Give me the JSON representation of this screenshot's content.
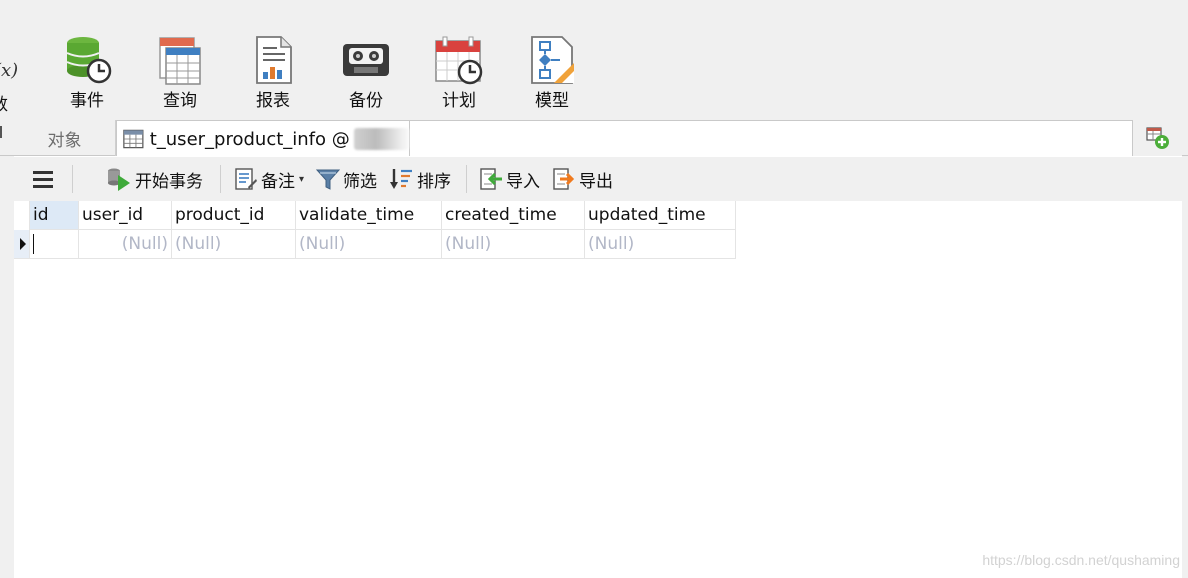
{
  "ribbon": {
    "partial_fx": "(x)",
    "partial_label": "数",
    "items": [
      {
        "label": "事件",
        "icon": "database-clock-icon"
      },
      {
        "label": "查询",
        "icon": "query-table-icon"
      },
      {
        "label": "报表",
        "icon": "report-chart-icon"
      },
      {
        "label": "备份",
        "icon": "backup-tape-icon"
      },
      {
        "label": "计划",
        "icon": "schedule-calendar-icon"
      },
      {
        "label": "模型",
        "icon": "model-diagram-icon"
      }
    ]
  },
  "tabs": {
    "objects_label": "对象",
    "active_label": "t_user_product_info @",
    "active_icon": "table-icon",
    "new_tab_icon": "new-table-plus-icon"
  },
  "toolbar": {
    "menu_icon": "hamburger-menu-icon",
    "begin_transaction": "开始事务",
    "comment": "备注",
    "filter": "筛选",
    "sort": "排序",
    "import": "导入",
    "export": "导出"
  },
  "grid": {
    "columns": [
      "id",
      "user_id",
      "product_id",
      "validate_time",
      "created_time",
      "updated_time"
    ],
    "rows": [
      [
        "",
        "(Null)",
        "(Null)",
        "(Null)",
        "(Null)",
        "(Null)"
      ]
    ]
  },
  "watermark": "https://blog.csdn.net/qushaming",
  "colors": {
    "accent_green": "#5aa832",
    "selected_header": "#dde9f6",
    "null_text": "#b2b7c7"
  }
}
